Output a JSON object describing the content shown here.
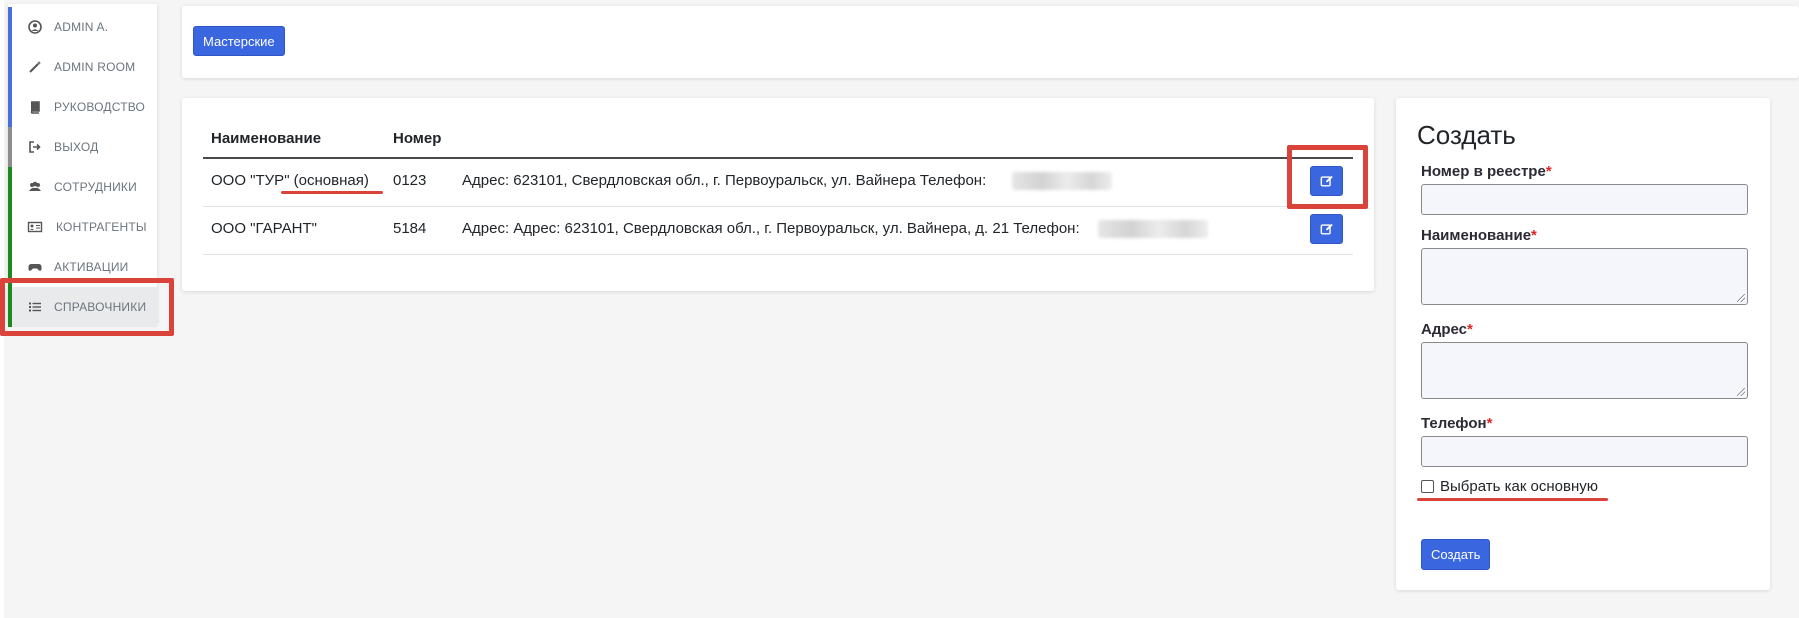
{
  "sidebar": {
    "items": [
      {
        "label": "ADMIN A.",
        "icon": "user-circle-icon",
        "bar_color": "#4a6fdc"
      },
      {
        "label": "ADMIN ROOM",
        "icon": "magic-wand-icon",
        "bar_color": "#4a6fdc"
      },
      {
        "label": "РУКОВОДСТВО",
        "icon": "book-icon",
        "bar_color": "#4a6fdc"
      },
      {
        "label": "ВЫХОД",
        "icon": "sign-out-icon",
        "bar_color": "#8c8c8c"
      },
      {
        "label": "СОТРУДНИКИ",
        "icon": "users-icon",
        "bar_color": "#1e8a1e"
      },
      {
        "label": "КОНТРАГЕНТЫ",
        "icon": "id-card-icon",
        "bar_color": "#1e8a1e"
      },
      {
        "label": "АКТИВАЦИИ",
        "icon": "gamepad-icon",
        "bar_color": "#1e8a1e"
      },
      {
        "label": "СПРАВОЧНИКИ",
        "icon": "list-icon",
        "bar_color": "#1e8a1e",
        "active": true
      }
    ]
  },
  "top": {
    "tab_button": "Мастерские"
  },
  "table": {
    "headers": [
      "Наименование",
      "Номер"
    ],
    "rows": [
      {
        "name": "ООО \"ТУР\" (основная)",
        "number": "0123",
        "details": "Адрес: 623101, Свердловская обл., г. Первоуральск, ул. Вайнера Телефон:"
      },
      {
        "name": "ООО \"ГАРАНТ\"",
        "number": "5184",
        "details": "Адрес: Адрес: 623101, Свердловская обл., г. Первоуральск, ул. Вайнера, д. 21 Телефон:"
      }
    ]
  },
  "form": {
    "title": "Создать",
    "fields": {
      "registry_number": {
        "label": "Номер в реестре",
        "value": ""
      },
      "name": {
        "label": "Наименование",
        "value": ""
      },
      "address": {
        "label": "Адрес",
        "value": ""
      },
      "phone": {
        "label": "Телефон",
        "value": ""
      }
    },
    "required_mark": "*",
    "checkbox_label": "Выбрать как основную",
    "checkbox_checked": false,
    "submit": "Создать"
  },
  "colors": {
    "primary": "#3a66e0",
    "highlight": "#d9433a",
    "required": "#e02424"
  }
}
